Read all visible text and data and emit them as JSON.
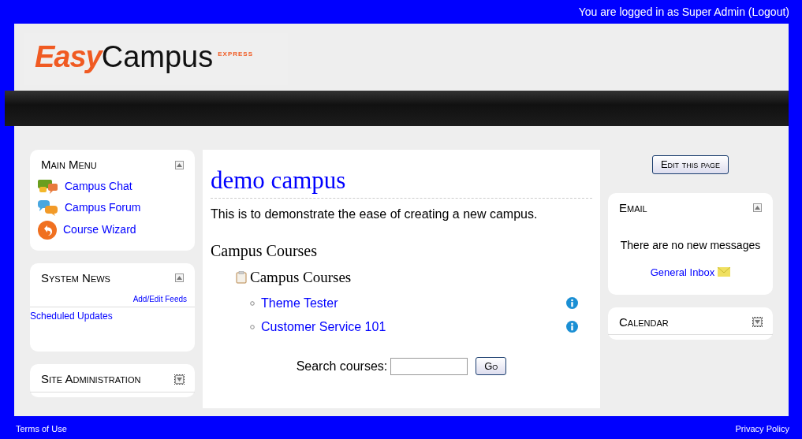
{
  "top_bar": {
    "login_text": "You are logged in as Super Admin",
    "logout": "(Logout)"
  },
  "logo": {
    "part_1": "Easy",
    "part_2": "Campus",
    "tag": "EXPRESS"
  },
  "left_blocks": [
    {
      "title": "Main Menu",
      "expanded": true,
      "kind": "menu",
      "items": [
        {
          "label": "Campus Chat",
          "kind": "chat"
        },
        {
          "label": "Campus Forum",
          "kind": "forum"
        },
        {
          "label": "Course Wizard",
          "kind": "wizard"
        }
      ]
    },
    {
      "title": "System News",
      "expanded": true,
      "kind": "news",
      "action": "Add/Edit Feeds",
      "items": [
        {
          "label": "Scheduled Updates"
        }
      ]
    },
    {
      "title": "Site Administration",
      "expanded": false
    }
  ],
  "main": {
    "title": "demo campus",
    "description": "This is to demonstrate the ease of creating a new campus.",
    "section_title": "Campus Courses",
    "category": "Campus Courses",
    "courses": [
      "Theme Tester",
      "Customer Service 101"
    ],
    "search_label": "Search courses:",
    "search_button": "Go"
  },
  "edit_button": "Edit this page",
  "right_blocks": [
    {
      "title": "Email",
      "expanded": true,
      "kind": "email",
      "message": "There are no new messages",
      "link": "General Inbox"
    },
    {
      "title": "Calendar",
      "expanded": false
    }
  ],
  "footer": {
    "left": "Terms of Use",
    "right": "Privacy Policy"
  }
}
